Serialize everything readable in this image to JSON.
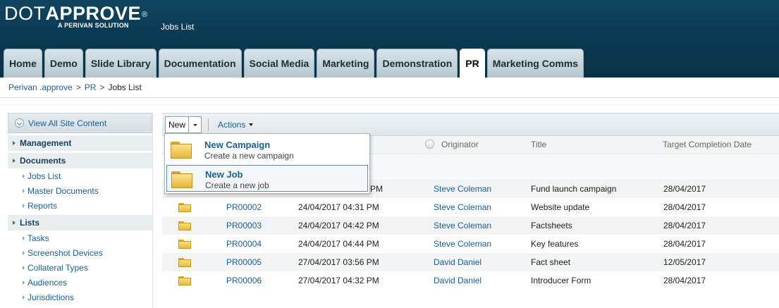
{
  "brand": {
    "logo_light": "DOT",
    "logo_bold": "APPROVE",
    "logo_reg": "®",
    "logo_sub": "A PERIVAN SOLUTION"
  },
  "site_title": "Jobs List",
  "tabs": [
    {
      "label": "Home",
      "active": false
    },
    {
      "label": "Demo",
      "active": false
    },
    {
      "label": "Slide Library",
      "active": false
    },
    {
      "label": "Documentation",
      "active": false
    },
    {
      "label": "Social Media",
      "active": false
    },
    {
      "label": "Marketing",
      "active": false
    },
    {
      "label": "Demonstration",
      "active": false
    },
    {
      "label": "PR",
      "active": true
    },
    {
      "label": "Marketing Comms",
      "active": false
    }
  ],
  "breadcrumb": {
    "items": [
      "Perivan .approve",
      "PR",
      "Jobs List"
    ],
    "separator": ">"
  },
  "leftnav": {
    "view_all": "View All Site Content",
    "sections": [
      {
        "heading": "Management",
        "items": []
      },
      {
        "heading": "Documents",
        "items": [
          "Jobs List",
          "Master Documents",
          "Reports"
        ]
      },
      {
        "heading": "Lists",
        "items": [
          "Tasks",
          "Screenshot Devices",
          "Collateral Types",
          "Audiences",
          "Jurisdictions"
        ]
      }
    ]
  },
  "toolbar": {
    "new_label": "New",
    "actions_label": "Actions"
  },
  "new_menu": [
    {
      "title": "New Campaign",
      "desc": "Create a new campaign",
      "selected": false,
      "icon": "folder-icon"
    },
    {
      "title": "New Job",
      "desc": "Create a new job",
      "selected": true,
      "icon": "folder-icon"
    }
  ],
  "list": {
    "columns": {
      "originator": "Originator",
      "title": "Title",
      "target": "Target Completion Date"
    },
    "rows": [
      {
        "id": "",
        "created": "PM",
        "originator": "Steve Coleman",
        "title": "Fund launch campaign",
        "target": "28/04/2017"
      },
      {
        "id": "PR00002",
        "created": "24/04/2017 04:31 PM",
        "originator": "Steve Coleman",
        "title": "Website update",
        "target": "28/04/2017"
      },
      {
        "id": "PR00003",
        "created": "24/04/2017 04:42 PM",
        "originator": "Steve Coleman",
        "title": "Factsheets",
        "target": "28/04/2017"
      },
      {
        "id": "PR00004",
        "created": "24/04/2017 04:44 PM",
        "originator": "Steve Coleman",
        "title": "Key features",
        "target": "28/04/2017"
      },
      {
        "id": "PR00005",
        "created": "27/04/2017 03:56 PM",
        "originator": "David Daniel",
        "title": "Fact sheet",
        "target": "12/05/2017"
      },
      {
        "id": "PR00006",
        "created": "27/04/2017 04:32 PM",
        "originator": "David Daniel",
        "title": "Introducer Form",
        "target": "28/04/2017"
      }
    ]
  },
  "colors": {
    "header_bg": "#0b3a52",
    "link": "#1b5f92",
    "tab_bg": "#c4d4dc",
    "folder": "#e9b93e"
  }
}
